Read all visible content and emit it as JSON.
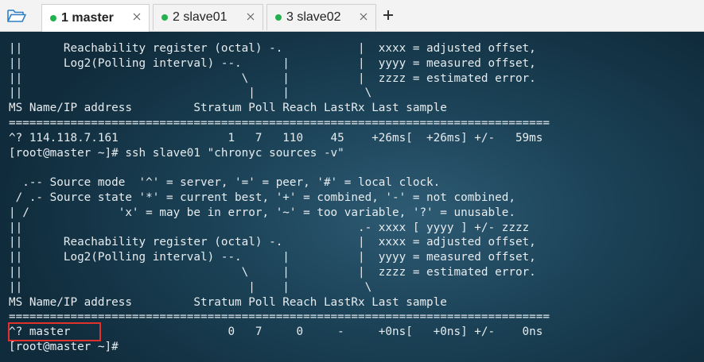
{
  "toolbar": {
    "open_icon": "folder-open-icon"
  },
  "tabs": [
    {
      "label": "1 master",
      "status_color": "#22b14c",
      "active": true
    },
    {
      "label": "2 slave01",
      "status_color": "#22b14c",
      "active": false
    },
    {
      "label": "3 slave02",
      "status_color": "#22b14c",
      "active": false
    }
  ],
  "add_tab_label": "+",
  "terminal": {
    "lines": [
      "||      Reachability register (octal) -.           |  xxxx = adjusted offset,",
      "||      Log2(Polling interval) --.      |          |  yyyy = measured offset,",
      "||                                \\     |          |  zzzz = estimated error.",
      "||                                 |    |           \\",
      "MS Name/IP address         Stratum Poll Reach LastRx Last sample",
      "===============================================================================",
      "^? 114.118.7.161                1   7   110    45    +26ms[  +26ms] +/-   59ms",
      "[root@master ~]# ssh slave01 \"chronyc sources -v\"",
      "",
      "  .-- Source mode  '^' = server, '=' = peer, '#' = local clock.",
      " / .- Source state '*' = current best, '+' = combined, '-' = not combined,",
      "| /             'x' = may be in error, '~' = too variable, '?' = unusable.",
      "||                                                 .- xxxx [ yyyy ] +/- zzzz",
      "||      Reachability register (octal) -.           |  xxxx = adjusted offset,",
      "||      Log2(Polling interval) --.      |          |  yyyy = measured offset,",
      "||                                \\     |          |  zzzz = estimated error.",
      "||                                 |    |           \\",
      "MS Name/IP address         Stratum Poll Reach LastRx Last sample",
      "===============================================================================",
      "^? master                       0   7     0     -     +0ns[   +0ns] +/-    0ns",
      "[root@master ~]#"
    ]
  }
}
